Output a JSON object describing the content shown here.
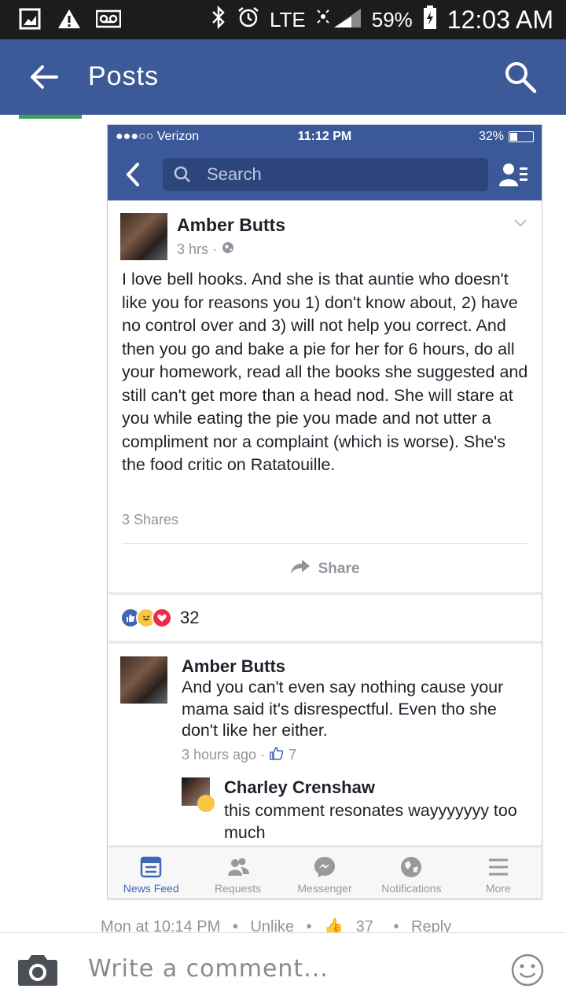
{
  "status_bar": {
    "lte": "LTE",
    "battery": "59%",
    "time": "12:03 AM"
  },
  "app_bar": {
    "title": "Posts"
  },
  "inner": {
    "ios_status": {
      "carrier": "●●●○○ Verizon",
      "time": "11:12 PM",
      "battery": "32%"
    },
    "search": {
      "placeholder": "Search"
    },
    "post": {
      "author": "Amber Butts",
      "time": "3 hrs ·",
      "body": "I love bell hooks. And she is that auntie who doesn't like you for reasons you 1) don't know about, 2) have no control over and 3) will not help you correct. And then you go and bake a pie for her for 6 hours, do all your homework, read all the books she suggested and still can't get more than a head nod. She will stare at you while eating the pie you made and not utter a compliment nor a complaint (which is worse). She's the food critic on Ratatouille.",
      "shares": "3 Shares",
      "share_label": "Share"
    },
    "reactions": {
      "count": "32"
    },
    "comment1": {
      "author": "Amber Butts",
      "text": "And you can't even say nothing cause your mama said it's disrespectful. Even tho she don't like her either.",
      "time": "3 hours ago ·",
      "likes": "7"
    },
    "comment2": {
      "author": "Charley Crenshaw",
      "text": "this comment resonates wayyyyyyy too much"
    },
    "tabs": [
      "News Feed",
      "Requests",
      "Messenger",
      "Notifications",
      "More"
    ]
  },
  "outer_comment_meta": {
    "time": "Mon at 10:14 PM",
    "sep": "•",
    "unlike": "Unlike",
    "likes": "37",
    "reply": "Reply"
  },
  "composer": {
    "placeholder": "Write a comment..."
  },
  "colors": {
    "brand": "#3d5a98",
    "inner_brand": "#3b5998",
    "link": "#4267b2"
  }
}
